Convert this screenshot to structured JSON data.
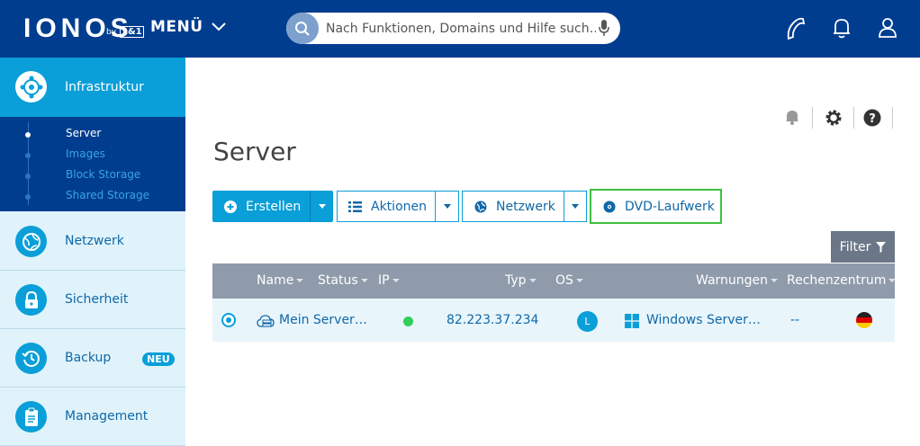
{
  "topbar": {
    "logo": "IONOS",
    "logo_by": "by",
    "logo_partner": "1&1",
    "menu_label": "MENÜ",
    "search_placeholder": "Nach Funktionen, Domains und Hilfe such…",
    "bg_color": "#003d8f"
  },
  "sidebar": {
    "active": {
      "label": "Infrastruktur",
      "icon": "infrastructure-icon"
    },
    "sub_items": [
      {
        "label": "Server",
        "active": true
      },
      {
        "label": "Images",
        "active": false
      },
      {
        "label": "Block Storage",
        "active": false
      },
      {
        "label": "Shared Storage",
        "active": false
      }
    ],
    "items": [
      {
        "label": "Netzwerk",
        "icon": "network-globe-icon"
      },
      {
        "label": "Sicherheit",
        "icon": "lock-icon"
      },
      {
        "label": "Backup",
        "icon": "backup-clock-icon",
        "badge": "NEU"
      },
      {
        "label": "Management",
        "icon": "clipboard-icon"
      }
    ]
  },
  "main": {
    "title": "Server",
    "buttons": {
      "create": "Erstellen",
      "actions": "Aktionen",
      "network": "Netzwerk",
      "dvd": "DVD-Laufwerk"
    },
    "filter_label": "Filter",
    "table": {
      "columns": [
        "Name",
        "Status",
        "IP",
        "Typ",
        "OS",
        "Warnungen",
        "Rechenzentrum"
      ],
      "rows": [
        {
          "name": "Mein Server…",
          "status": "online",
          "ip": "82.223.37.234",
          "os_badge": "L",
          "type": "Windows Server…",
          "warnings": "--",
          "datacenter": "de-flag"
        }
      ]
    }
  },
  "colors": {
    "accent": "#0a9fd8",
    "highlight_border": "#3fbf3f",
    "status_online": "#2fcf5a"
  }
}
